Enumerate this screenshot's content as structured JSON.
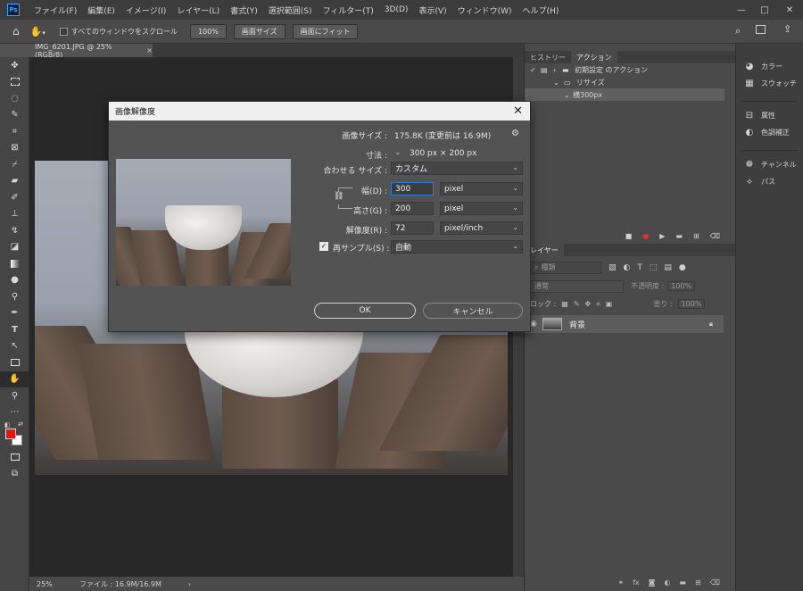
{
  "menubar": {
    "logo": "Ps",
    "items": [
      "ファイル(F)",
      "編集(E)",
      "イメージ(I)",
      "レイヤー(L)",
      "書式(Y)",
      "選択範囲(S)",
      "フィルター(T)",
      "3D(D)",
      "表示(V)",
      "ウィンドウ(W)",
      "ヘルプ(H)"
    ],
    "controls": {
      "minimize": "—",
      "maximize": "□",
      "close": "✕"
    }
  },
  "options_bar": {
    "scroll_all_label": "すべてのウィンドウをスクロール",
    "zoom_button": "100%",
    "fit_screen_button": "画面サイズ",
    "fill_screen_button": "画面にフィット"
  },
  "document": {
    "tab_title": "IMG_6201.JPG @ 25% (RGB/8)",
    "tab_close": "×",
    "status_zoom": "25%",
    "status_file": "ファイル : 16.9M/16.9M"
  },
  "dialog": {
    "title": "画像解像度",
    "image_size_label": "画像サイズ :",
    "image_size_value": "175.8K (変更前は 16.9M)",
    "dimensions_label": "寸法 :",
    "dimensions_value": "300 px × 200 px",
    "fit_to_label": "合わせる サイズ :",
    "fit_to_value": "カスタム",
    "width_label": "幅(D) :",
    "width_value": "300",
    "width_unit": "pixel",
    "height_label": "高さ(G) :",
    "height_value": "200",
    "height_unit": "pixel",
    "resolution_label": "解像度(R) :",
    "resolution_value": "72",
    "resolution_unit": "pixel/inch",
    "resample_label": "再サンプル(S) :",
    "resample_value": "自動",
    "ok_label": "OK",
    "cancel_label": "キャンセル"
  },
  "actions_panel": {
    "tabs": [
      "ヒストリー",
      "アクション"
    ],
    "rows": [
      "初期設定 のアクション",
      "リサイズ",
      "横300px"
    ]
  },
  "layers_panel": {
    "tab": "レイヤー",
    "search_placeholder": "種類",
    "blend_mode": "通常",
    "opacity_label": "不透明度 :",
    "opacity_value": "100%",
    "lock_label": "ロック :",
    "fill_label": "塗り :",
    "fill_value": "100%",
    "layer_name": "背景"
  },
  "dock": {
    "items": [
      "カラー",
      "スウォッチ",
      "属性",
      "色調補正",
      "チャンネル",
      "パス"
    ]
  },
  "colors": {
    "foreground": "#e8140c",
    "background": "#ffffff",
    "record": "#e03030"
  }
}
